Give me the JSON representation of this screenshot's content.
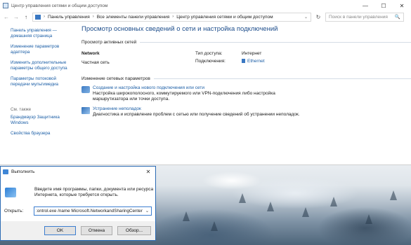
{
  "window": {
    "title": "Центр управления сетями и общим доступом",
    "controls": {
      "minimize": "—",
      "maximize": "☐",
      "close": "✕"
    }
  },
  "address": {
    "back": "←",
    "forward": "→",
    "up": "↑",
    "crumbs": [
      "Панель управления",
      "Все элементы панели управления",
      "Центр управления сетями и общим доступом"
    ],
    "separator": "›",
    "dropdown": "⌄",
    "refresh": "↻",
    "search_placeholder": "Поиск в панели управления",
    "search_icon": "🔍"
  },
  "sidebar": {
    "links": [
      "Панель управления — домашняя страница",
      "Изменение параметров адаптера",
      "Изменить дополнительные параметры общего доступа",
      "Параметры потоковой передачи мультимедиа"
    ],
    "see_also_title": "См. также",
    "see_also": [
      "Брандмауэр Защитника Windows",
      "Свойства браузера"
    ]
  },
  "main": {
    "title": "Просмотр основных сведений о сети и настройка подключений",
    "active_networks_header": "Просмотр активных сетей",
    "network_name": "Network",
    "network_type": "Частная сеть",
    "access_type_label": "Тип доступа:",
    "access_type_value": "Интернет",
    "connections_label": "Подключения:",
    "connections_value": "Ethernet",
    "change_header": "Изменение сетевых параметров",
    "tasks": [
      {
        "link": "Создание и настройка нового подключения или сети",
        "desc": "Настройка широкополосного, коммутируемого или VPN-подключения либо настройка маршрутизатора или точки доступа.",
        "icon": "network-setup-icon"
      },
      {
        "link": "Устранение неполадок",
        "desc": "Диагностика и исправление проблем с сетью или получение сведений об устранении неполадок.",
        "icon": "troubleshoot-icon"
      }
    ]
  },
  "run_dialog": {
    "title": "Выполнить",
    "close": "✕",
    "description": "Введите имя программы, папки, документа или ресурса Интернета, которые требуется открыть.",
    "open_label": "Открыть:",
    "command": ":ontrol.exe /name Microsoft.NetworkandSharingCenter",
    "dropdown": "⌄",
    "ok": "OK",
    "cancel": "Отмена",
    "browse": "Обзор..."
  },
  "colors": {
    "link": "#1b5ea6",
    "title": "#1e4e8c",
    "dialog_border": "#2c6bb4"
  }
}
